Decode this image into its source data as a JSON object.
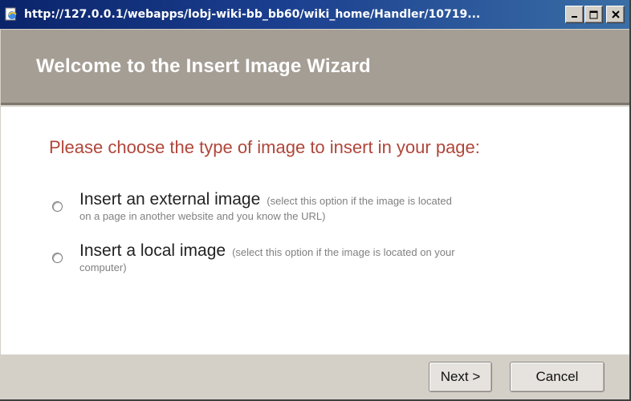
{
  "window": {
    "title": "http://127.0.0.1/webapps/lobj-wiki-bb_bb60/wiki_home/Handler/10719...",
    "icon": "ie-page-icon",
    "controls": {
      "minimize": "minimize-icon",
      "maximize": "maximize-icon",
      "close": "close-icon"
    }
  },
  "header": {
    "title": "Welcome to the Insert Image Wizard"
  },
  "main": {
    "prompt": "Please choose the type of image to insert in your page:",
    "options": [
      {
        "label": "Insert an external image",
        "hint_inline": "(select this option if the image is located",
        "hint_wrap": "on a page in another website and you know the URL)",
        "selected": false
      },
      {
        "label": "Insert a local image",
        "hint_inline": "(select this option if the image is located on your",
        "hint_wrap": "computer)",
        "selected": false
      }
    ]
  },
  "footer": {
    "next_label": "Next >",
    "cancel_label": "Cancel"
  },
  "colors": {
    "titlebar": "#0a246a",
    "header_bg": "#a59e95",
    "prompt_text": "#b0463a",
    "footer_bg": "#d4d0c8"
  }
}
